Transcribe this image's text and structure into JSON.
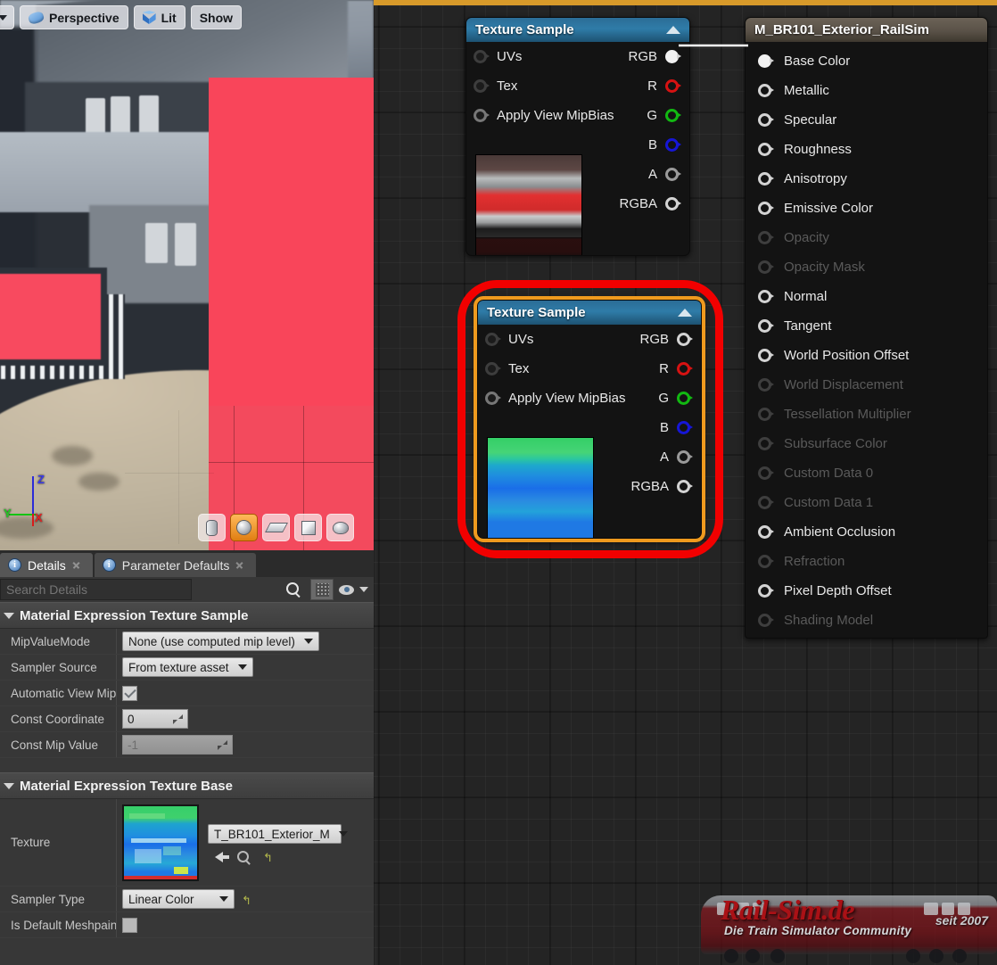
{
  "viewport": {
    "toolbar": {
      "dropdown_icon": "chevron-down-icon",
      "perspective_label": "Perspective",
      "perspective_icon": "camera-icon",
      "lit_label": "Lit",
      "lit_icon": "cube-icon",
      "show_label": "Show"
    },
    "gizmo": {
      "x": "X",
      "y": "Y",
      "z": "Z"
    },
    "mesh_buttons": [
      {
        "name": "cylinder",
        "icon": "cylinder-icon",
        "active": false
      },
      {
        "name": "sphere",
        "icon": "sphere-icon",
        "active": true
      },
      {
        "name": "plane",
        "icon": "plane-icon",
        "active": false
      },
      {
        "name": "cube",
        "icon": "cube-icon",
        "active": false
      },
      {
        "name": "teapot",
        "icon": "teapot-icon",
        "active": false
      }
    ]
  },
  "details": {
    "tabs": [
      {
        "label": "Details",
        "icon": "info-icon",
        "active": true
      },
      {
        "label": "Parameter Defaults",
        "icon": "info-icon",
        "active": false
      }
    ],
    "search": {
      "placeholder": "Search Details",
      "icon": "search-icon"
    },
    "toolbar": {
      "grid_icon": "grid-icon",
      "eye_icon": "eye-icon",
      "caret_icon": "chevron-down-icon"
    },
    "sections": [
      {
        "title": "Material Expression Texture Sample",
        "rows": [
          {
            "name": "MipValueMode",
            "type": "combo",
            "value": "None (use computed mip level)"
          },
          {
            "name": "Sampler Source",
            "type": "combo",
            "value": "From texture asset"
          },
          {
            "name": "Automatic View Mip Bias",
            "type": "checkbox",
            "value": "checked"
          },
          {
            "name": "Const Coordinate",
            "type": "number",
            "value": "0"
          },
          {
            "name": "Const Mip Value",
            "type": "number-disabled",
            "value": "-1"
          }
        ]
      },
      {
        "title": "Material Expression Texture Base",
        "rows": [
          {
            "name": "Texture",
            "type": "asset",
            "value": "T_BR101_Exterior_M",
            "actions": [
              "browse-back-icon",
              "find-in-browser-icon",
              "reset-icon"
            ]
          },
          {
            "name": "Sampler Type",
            "type": "combo-reset",
            "value": "Linear Color"
          },
          {
            "name": "Is Default Meshpaint Texture",
            "type": "checkbox-off",
            "value": "unchecked"
          }
        ]
      }
    ]
  },
  "graph": {
    "nodes": [
      {
        "id": "texture-sample-top",
        "title": "Texture Sample",
        "collapse_icon": "triangle-up-icon",
        "selected": false,
        "inputs": [
          {
            "label": "UVs",
            "connected": false
          },
          {
            "label": "Tex",
            "connected": false
          },
          {
            "label": "Apply View MipBias",
            "connected": false
          }
        ],
        "outputs": [
          {
            "label": "RGB",
            "color": "#f2f2f2",
            "filled": true,
            "connected": true
          },
          {
            "label": "R",
            "color": "#d61212",
            "filled": false,
            "connected": false
          },
          {
            "label": "G",
            "color": "#12b812",
            "filled": false,
            "connected": false
          },
          {
            "label": "B",
            "color": "#1616d6",
            "filled": false,
            "connected": false
          },
          {
            "label": "A",
            "color": "#9a9a9a",
            "filled": false,
            "connected": false
          },
          {
            "label": "RGBA",
            "color": "#d3d3d3",
            "filled": false,
            "connected": false
          }
        ]
      },
      {
        "id": "texture-sample-selected",
        "title": "Texture Sample",
        "collapse_icon": "triangle-up-icon",
        "selected": true,
        "inputs": [
          {
            "label": "UVs",
            "connected": false
          },
          {
            "label": "Tex",
            "connected": false
          },
          {
            "label": "Apply View MipBias",
            "connected": false
          }
        ],
        "outputs": [
          {
            "label": "RGB",
            "color": "#d3d3d3",
            "filled": false,
            "connected": false
          },
          {
            "label": "R",
            "color": "#d61212",
            "filled": false,
            "connected": false
          },
          {
            "label": "G",
            "color": "#12b812",
            "filled": false,
            "connected": false
          },
          {
            "label": "B",
            "color": "#1616d6",
            "filled": false,
            "connected": false
          },
          {
            "label": "A",
            "color": "#9a9a9a",
            "filled": false,
            "connected": false
          },
          {
            "label": "RGBA",
            "color": "#d3d3d3",
            "filled": false,
            "connected": false
          }
        ]
      }
    ],
    "material_output": {
      "title": "M_BR101_Exterior_RailSim",
      "pins": [
        {
          "label": "Base Color",
          "enabled": true,
          "connected": true
        },
        {
          "label": "Metallic",
          "enabled": true,
          "connected": false
        },
        {
          "label": "Specular",
          "enabled": true,
          "connected": false
        },
        {
          "label": "Roughness",
          "enabled": true,
          "connected": false
        },
        {
          "label": "Anisotropy",
          "enabled": true,
          "connected": false
        },
        {
          "label": "Emissive Color",
          "enabled": true,
          "connected": false
        },
        {
          "label": "Opacity",
          "enabled": false,
          "connected": false
        },
        {
          "label": "Opacity Mask",
          "enabled": false,
          "connected": false
        },
        {
          "label": "Normal",
          "enabled": true,
          "connected": false
        },
        {
          "label": "Tangent",
          "enabled": true,
          "connected": false
        },
        {
          "label": "World Position Offset",
          "enabled": true,
          "connected": false
        },
        {
          "label": "World Displacement",
          "enabled": false,
          "connected": false
        },
        {
          "label": "Tessellation Multiplier",
          "enabled": false,
          "connected": false
        },
        {
          "label": "Subsurface Color",
          "enabled": false,
          "connected": false
        },
        {
          "label": "Custom Data 0",
          "enabled": false,
          "connected": false
        },
        {
          "label": "Custom Data 1",
          "enabled": false,
          "connected": false
        },
        {
          "label": "Ambient Occlusion",
          "enabled": true,
          "connected": false
        },
        {
          "label": "Refraction",
          "enabled": false,
          "connected": false
        },
        {
          "label": "Pixel Depth Offset",
          "enabled": true,
          "connected": false
        },
        {
          "label": "Shading Model",
          "enabled": false,
          "connected": false
        }
      ]
    },
    "annotation": {
      "shape": "rounded-rectangle",
      "color": "#f20000"
    }
  },
  "watermark": {
    "title": "Rail-Sim.de",
    "subtitle": "Die Train Simulator Community",
    "since": "seit 2007"
  }
}
